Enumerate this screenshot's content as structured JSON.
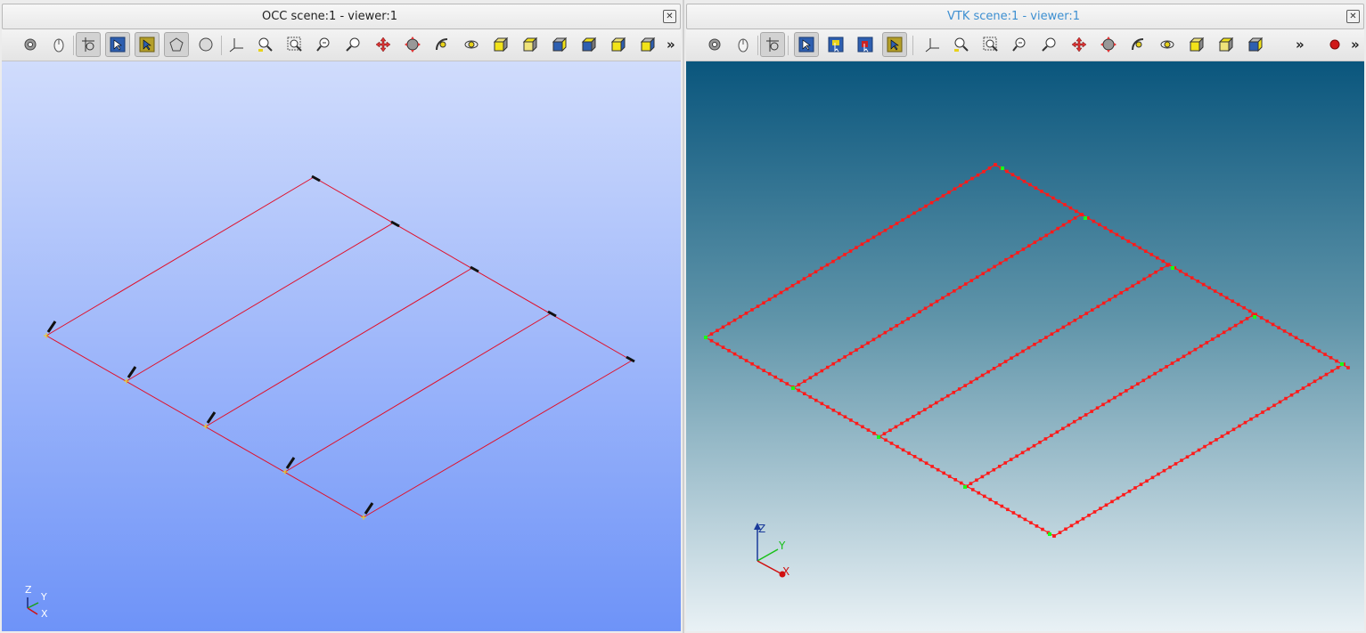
{
  "occ": {
    "title": "OCC scene:1 - viewer:1",
    "close_glyph": "✕",
    "more_glyph": "»",
    "toolbar": [
      "rotation-point-icon",
      "dynamic-mode-icon",
      "select-mode-icon",
      "select-pointer-icon",
      "select-highlight-icon",
      "polygon-select-icon",
      "circle-select-icon",
      "trihedron-icon",
      "zoom-fit-all-icon",
      "zoom-window-icon",
      "zoom-selection-icon",
      "zoom-icon",
      "pan-icon",
      "global-pan-icon",
      "rotate-icon",
      "reset-view-icon",
      "front-view-icon",
      "back-view-icon",
      "top-view-icon",
      "bottom-view-icon",
      "left-view-icon",
      "right-view-icon"
    ],
    "axis": {
      "z": "Z",
      "y": "Y",
      "x": "X"
    },
    "colors": {
      "edge": "#e0102a",
      "bg_top": "#d0dcfc",
      "bg_bottom": "#6e93f8"
    }
  },
  "vtk": {
    "title": "VTK scene:1 - viewer:1",
    "close_glyph": "✕",
    "more_glyph": "»",
    "toolbar": [
      "rotation-point-icon",
      "dynamic-mode-icon",
      "select-mode-icon",
      "select-pointer-icon",
      "rubber-select-icon",
      "point-select-icon",
      "highlight-select-icon",
      "trihedron-icon",
      "zoom-fit-all-icon",
      "zoom-window-icon",
      "zoom-selection-icon",
      "zoom-icon",
      "pan-icon",
      "global-pan-icon",
      "rotate-icon",
      "reset-view-icon",
      "front-view-icon",
      "back-view-icon",
      "top-view-icon",
      "record-icon"
    ],
    "axis": {
      "z": "Z",
      "y": "Y",
      "x": "X"
    },
    "colors": {
      "edge": "#ff1a1a",
      "node": "#19ff19",
      "bg_top": "#0a567d",
      "bg_bottom": "#e9f1f5"
    }
  }
}
